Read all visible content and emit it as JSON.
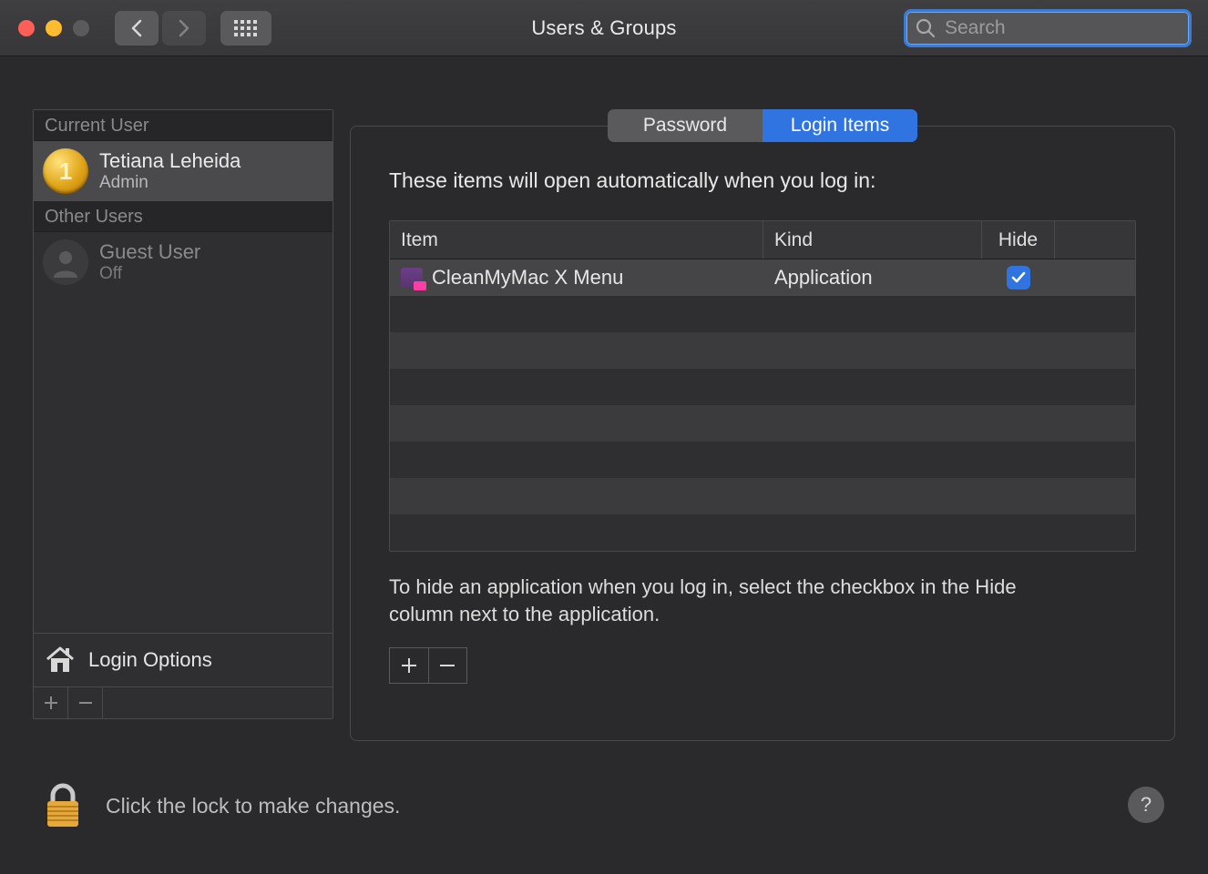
{
  "window": {
    "title": "Users & Groups",
    "search_placeholder": "Search"
  },
  "sidebar": {
    "current_user_header": "Current User",
    "other_users_header": "Other Users",
    "current_user": {
      "name": "Tetiana Leheida",
      "role": "Admin"
    },
    "other_users": [
      {
        "name": "Guest User",
        "role": "Off"
      }
    ],
    "login_options_label": "Login Options"
  },
  "tabs": {
    "password": "Password",
    "login_items": "Login Items",
    "active": "login_items"
  },
  "panel": {
    "heading": "These items will open automatically when you log in:",
    "columns": {
      "item": "Item",
      "kind": "Kind",
      "hide": "Hide"
    },
    "rows": [
      {
        "item": "CleanMyMac X Menu",
        "kind": "Application",
        "hide": true
      }
    ],
    "note": "To hide an application when you log in, select the checkbox in the Hide column next to the application."
  },
  "footer": {
    "lock_text": "Click the lock to make changes.",
    "help": "?"
  }
}
